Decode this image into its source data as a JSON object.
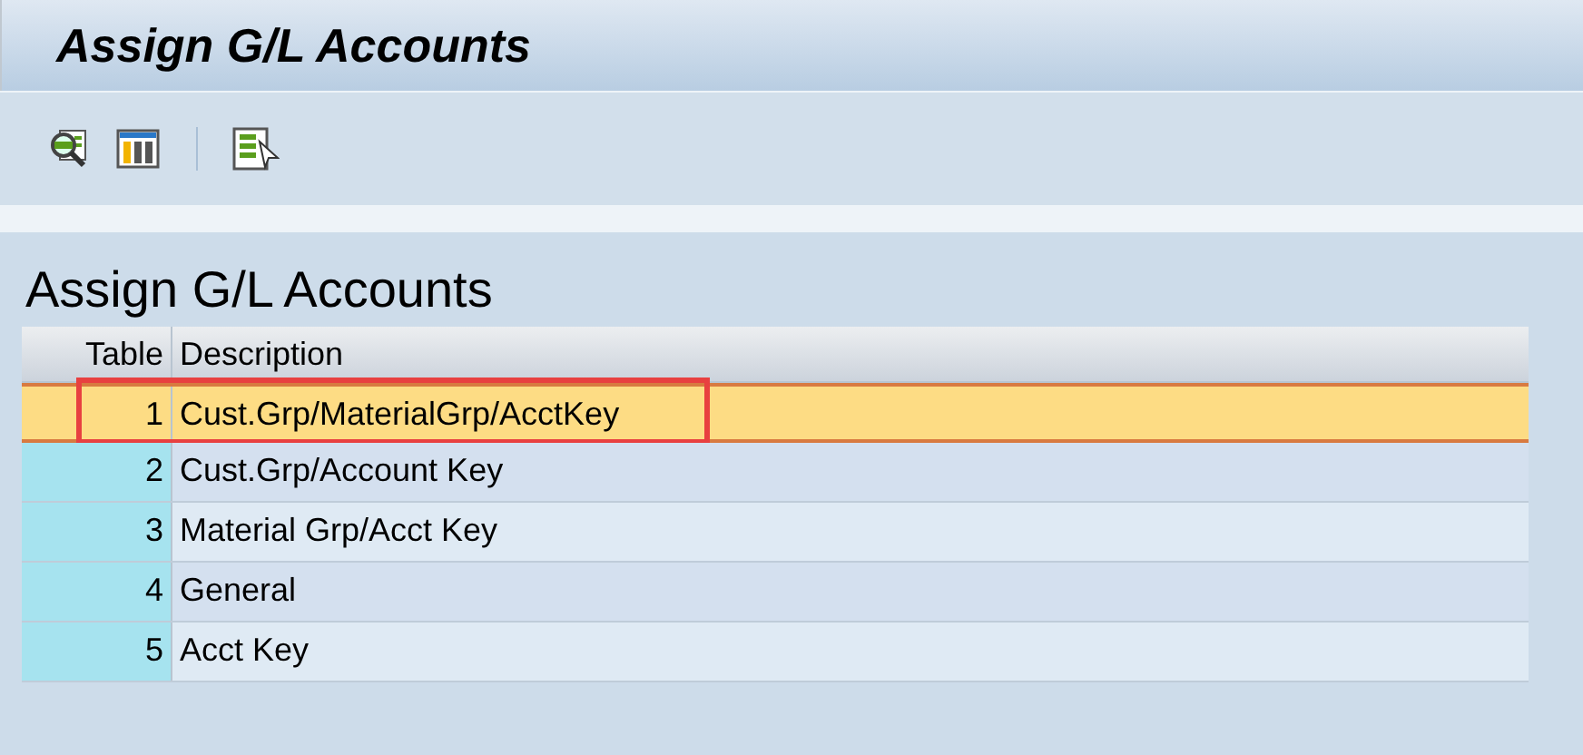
{
  "window": {
    "title": "Assign G/L Accounts"
  },
  "toolbar": {
    "buttons": [
      {
        "kind": "find"
      },
      {
        "kind": "layout"
      },
      {
        "kind": "separator"
      },
      {
        "kind": "select"
      }
    ]
  },
  "heading": "Assign G/L Accounts",
  "table": {
    "columns": [
      "Table",
      "Description"
    ],
    "rows": [
      {
        "table": "1",
        "description": "Cust.Grp/MaterialGrp/AcctKey",
        "selected": true,
        "highlighted": true
      },
      {
        "table": "2",
        "description": "Cust.Grp/Account Key",
        "selected": false,
        "highlighted": false
      },
      {
        "table": "3",
        "description": "Material Grp/Acct Key",
        "selected": false,
        "highlighted": false
      },
      {
        "table": "4",
        "description": "General",
        "selected": false,
        "highlighted": false
      },
      {
        "table": "5",
        "description": "Acct Key",
        "selected": false,
        "highlighted": false
      }
    ]
  }
}
